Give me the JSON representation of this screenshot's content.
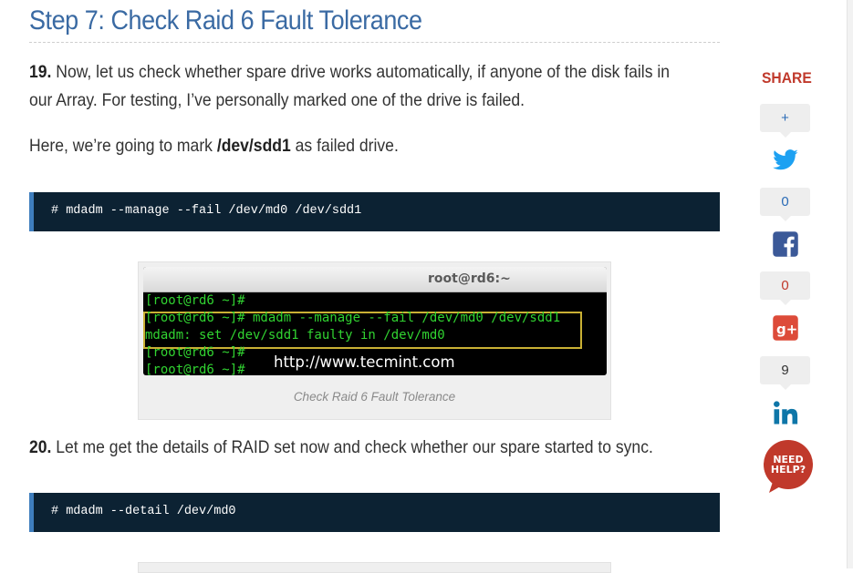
{
  "article": {
    "step_title": "Step 7: Check Raid 6 Fault Tolerance",
    "p19_number": "19.",
    "p19_text": "Now, let us check whether spare drive works automatically, if anyone of the disk fails in our Array. For testing, I’ve personally marked one of the drive is failed.",
    "p_mark_prefix": "Here, we’re going to mark",
    "p_mark_device": "/dev/sdd1",
    "p_mark_suffix": "as failed drive.",
    "code1": "# mdadm --manage --fail /dev/md0 /dev/sdd1",
    "figure1": {
      "terminal_title": "root@rd6:~",
      "lines": [
        "[root@rd6 ~]#",
        "[root@rd6 ~]# mdadm --manage --fail /dev/md0 /dev/sdd1",
        "mdadm: set /dev/sdd1 faulty in /dev/md0",
        "[root@rd6 ~]#",
        "[root@rd6 ~]#"
      ],
      "watermark_url": "http://www.tecmint.com",
      "caption": "Check Raid 6 Fault Tolerance"
    },
    "p20_number": "20.",
    "p20_text": "Let me get the details of RAID set now and check whether our spare started to sync.",
    "code2": "# mdadm --detail /dev/md0"
  },
  "share": {
    "label": "SHARE",
    "plus_label": "+",
    "twitter_count": "0",
    "facebook_count": "0",
    "linkedin_count": "9",
    "need_help_line1": "NEED",
    "need_help_line2": "HELP?",
    "colors": {
      "twitter": "#1da1f2",
      "facebook": "#3b5998",
      "google_plus": "#dd4b39",
      "linkedin": "#0e76a8",
      "need_help": "#c0392b"
    },
    "icons": [
      "twitter-icon",
      "facebook-icon",
      "google-plus-icon",
      "linkedin-icon",
      "need-help-icon"
    ]
  }
}
